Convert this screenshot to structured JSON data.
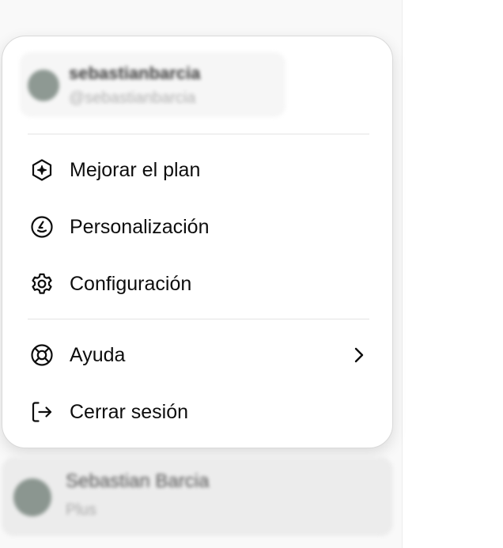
{
  "profile": {
    "name": "sebastianbarcia",
    "handle": "@sebastianbarcia"
  },
  "menu": {
    "items": [
      {
        "label": "Mejorar el plan",
        "icon": "upgrade-hexagon-sparkle-icon"
      },
      {
        "label": "Personalización",
        "icon": "personalization-icon"
      },
      {
        "label": "Configuración",
        "icon": "gear-icon"
      },
      {
        "label": "Ayuda",
        "icon": "lifebuoy-icon",
        "has_submenu": true
      },
      {
        "label": "Cerrar sesión",
        "icon": "logout-icon"
      }
    ]
  },
  "account": {
    "name": "Sebastian Barcia",
    "plan": "Plus"
  },
  "colors": {
    "sidebar_bg": "#f9f9f9",
    "menu_bg": "#ffffff",
    "text": "#0d0d0d"
  }
}
